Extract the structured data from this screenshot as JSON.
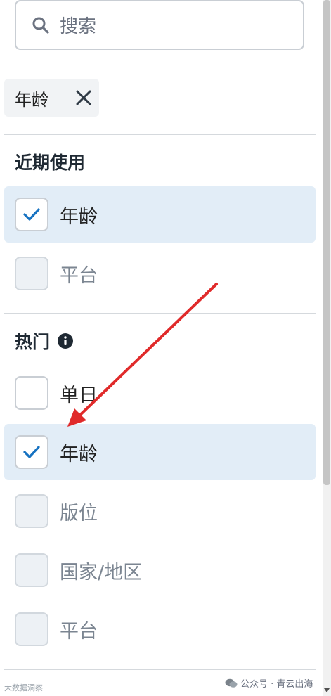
{
  "search": {
    "placeholder": "搜索",
    "icon": "search-icon"
  },
  "active_filter": {
    "label": "年龄",
    "close_icon": "close-icon"
  },
  "recent": {
    "title": "近期使用",
    "items": [
      {
        "label": "年龄",
        "checked": true
      },
      {
        "label": "平台",
        "checked": false,
        "disabled": true
      }
    ]
  },
  "popular": {
    "title": "热门",
    "info_icon": "info-icon",
    "items": [
      {
        "label": "单日",
        "checked": false
      },
      {
        "label": "年龄",
        "checked": true
      },
      {
        "label": "版位",
        "checked": false,
        "disabled": true
      },
      {
        "label": "国家/地区",
        "checked": false,
        "disabled": true
      },
      {
        "label": "平台",
        "checked": false,
        "disabled": true
      }
    ]
  },
  "watermark": {
    "left": "大数据洞察",
    "right": "公众号 · 青云出海"
  },
  "colors": {
    "accent": "#1672c1",
    "selected_bg": "#e2edf7",
    "arrow": "#e02a2a"
  }
}
